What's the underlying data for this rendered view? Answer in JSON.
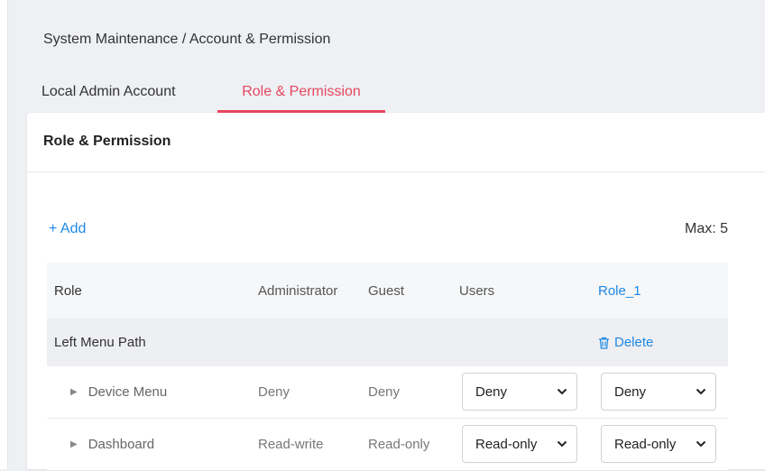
{
  "breadcrumb": "System Maintenance / Account & Permission",
  "tabs": [
    {
      "label": "Local Admin Account",
      "active": false
    },
    {
      "label": "Role & Permission",
      "active": true
    }
  ],
  "panel": {
    "title": "Role & Permission",
    "add_label": "+ Add",
    "max_label": "Max: 5"
  },
  "table": {
    "headers": {
      "role": "Role",
      "administrator": "Administrator",
      "guest": "Guest",
      "users": "Users",
      "role1": "Role_1"
    },
    "group": {
      "label": "Left Menu Path",
      "delete_label": "Delete"
    },
    "rows": [
      {
        "name": "Device Menu",
        "administrator": "Deny",
        "guest": "Deny",
        "users": "Deny",
        "role1": "Deny"
      },
      {
        "name": "Dashboard",
        "administrator": "Read-write",
        "guest": "Read-only",
        "users": "Read-only",
        "role1": "Read-only"
      }
    ]
  },
  "colors": {
    "accent": "#e6475f",
    "link": "#1e88e5"
  },
  "icons": {
    "expand": "triangle-right-icon",
    "delete": "trash-icon",
    "dropdown": "chevron-down-icon"
  }
}
